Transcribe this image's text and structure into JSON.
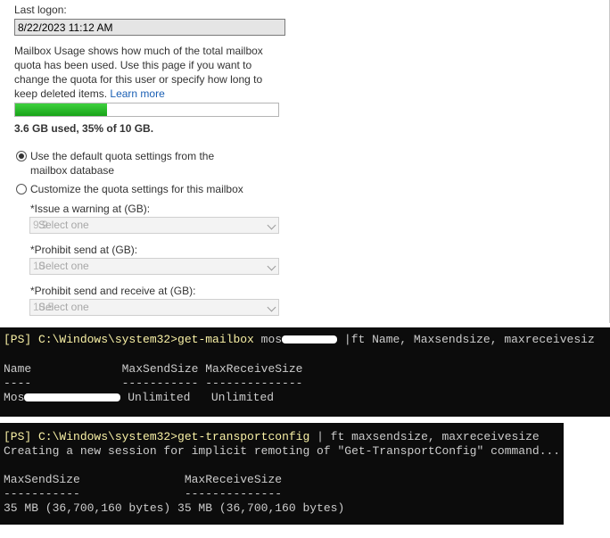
{
  "mailbox": {
    "last_logon_label": "Last logon:",
    "last_logon_value": "8/22/2023 11:12 AM",
    "description": "Mailbox Usage shows how much of the total mailbox quota has been used. Use this page if you want to change the quota for this user or specify how long to keep deleted items.",
    "learn_more": "Learn more",
    "usage_fraction": 0.35,
    "usage_text": "3.6 GB used, 35% of 10 GB.",
    "option_default": "Use the default quota settings from the mailbox database",
    "option_custom": "Customize the quota settings for this mailbox",
    "selected_option": "default",
    "fields": [
      {
        "label": "*Issue a warning at (GB):",
        "ghost": "9.9",
        "placeholder": "Select one"
      },
      {
        "label": "*Prohibit send at (GB):",
        "ghost": "10",
        "placeholder": "Select one"
      },
      {
        "label": "*Prohibit send and receive at (GB):",
        "ghost": "10.5",
        "placeholder": "Select one"
      }
    ]
  },
  "console1": {
    "prompt": "[PS] C:\\Windows\\system32>",
    "cmd_a": "get-mailbox",
    "cmd_b": " mos",
    "cmd_c": " |ft Name, Maxsendsize, maxreceivesiz",
    "header": "Name             MaxSendSize MaxReceiveSize",
    "rule": "----             ----------- --------------",
    "row_name": "Mos",
    "row_rest": "Unlimited   Unlimited"
  },
  "console2": {
    "prompt": "[PS] C:\\Windows\\system32>",
    "cmd_a": "get-transportconfig",
    "cmd_b": " | ft maxsendsize, maxreceivesize",
    "line2": "Creating a new session for implicit remoting of \"Get-TransportConfig\" command...",
    "header": "MaxSendSize               MaxReceiveSize",
    "rule": "-----------               --------------",
    "row": "35 MB (36,700,160 bytes) 35 MB (36,700,160 bytes)"
  },
  "colors": {
    "console_bg": "#0c0c0c",
    "prompt_yellow": "#f9f1a5",
    "progress_green": "#2bbd2b",
    "link_blue": "#1a5fb4"
  }
}
